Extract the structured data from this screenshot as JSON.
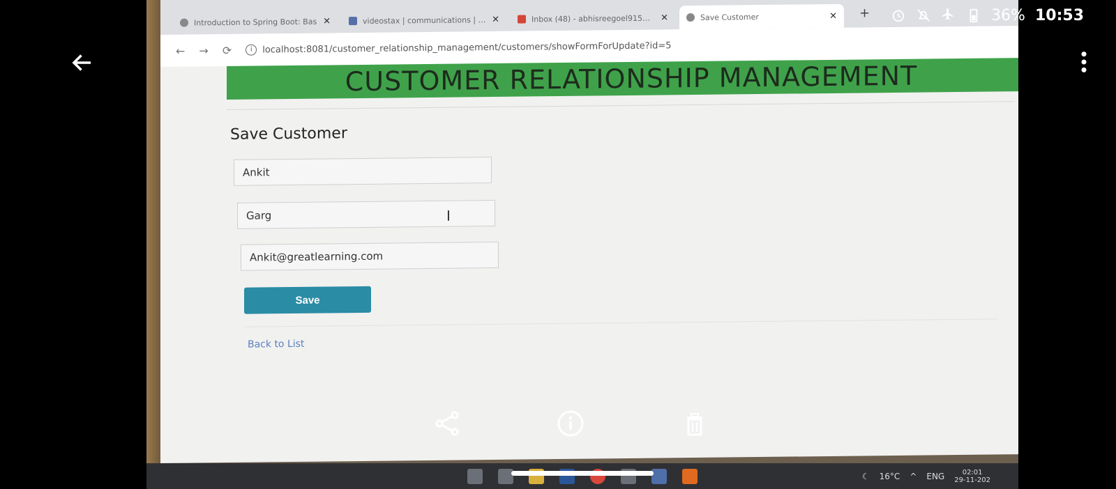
{
  "status": {
    "battery": "36%",
    "time": "10:53"
  },
  "browser": {
    "tabs": [
      {
        "title": "Introduction to Spring Boot: Bas",
        "active": false
      },
      {
        "title": "videostax | communications | limi",
        "active": false
      },
      {
        "title": "Inbox (48) - abhisreegoel915@gr",
        "active": false
      },
      {
        "title": "Save Customer",
        "active": true
      }
    ],
    "url": "localhost:8081/customer_relationship_management/customers/showFormForUpdate?id=5"
  },
  "page": {
    "header": "CUSTOMER RELATIONSHIP MANAGEMENT",
    "form_title": "Save Customer",
    "first_name": "Ankit",
    "last_name": "Garg",
    "email": "Ankit@greatlearning.com",
    "save_label": "Save",
    "back_link": "Back to List"
  },
  "taskbar": {
    "temperature": "16°C",
    "language": "ENG",
    "time": "02:01",
    "date": "29-11-202"
  },
  "colors": {
    "header_green": "#3fa24a",
    "save_button": "#2b8ca6",
    "link_blue": "#5a7fc0"
  }
}
